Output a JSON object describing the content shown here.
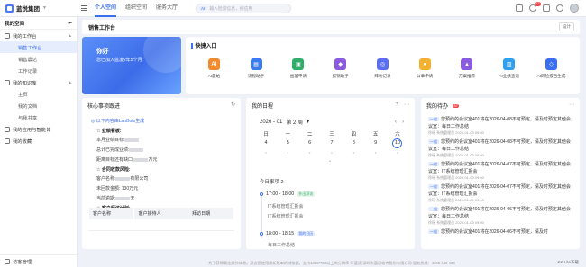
{
  "header": {
    "brand": "蓝悦集团",
    "tabs": [
      "个人空间",
      "组织空间",
      "服务大厅"
    ],
    "active_tab": 0,
    "search": {
      "tag": "AI",
      "placeholder": "输入检索信息，搜应用"
    },
    "notification_count": "27"
  },
  "sidebar": {
    "title": "我的空间",
    "groups": [
      {
        "label": "我的工作台",
        "items": [
          "销售工作台",
          "销售晨达",
          "工作记录"
        ]
      },
      {
        "label": "我的知识库",
        "items": [
          "主页",
          "我的文档",
          "与我共享"
        ]
      },
      {
        "label": "我的应用与智能体",
        "items": []
      },
      {
        "label": "我的收藏",
        "items": []
      }
    ],
    "footer": "访客管理"
  },
  "page": {
    "title": "销售工作台",
    "settings_label": "设计"
  },
  "welcome": {
    "greeting": "你好",
    "subtitle": "您已加入蓝凌2年5个月"
  },
  "quick_entry": {
    "title": "快捷入口",
    "items": [
      {
        "label": "AI晨始",
        "icon": "ai-icon",
        "glyph": "AI",
        "color": "#f28b2f"
      },
      {
        "label": "流程助手",
        "icon": "workflow-icon",
        "glyph": "▤",
        "color": "#3a7bf0"
      },
      {
        "label": "出差申请",
        "icon": "briefcase-icon",
        "glyph": "▣",
        "color": "#2fae6a"
      },
      {
        "label": "报销助手",
        "icon": "wallet-icon",
        "glyph": "◆",
        "color": "#8a5ae0"
      },
      {
        "label": "拜访记录",
        "icon": "team-icon",
        "glyph": "◎",
        "color": "#5a6ef0"
      },
      {
        "label": "公章申请",
        "icon": "stamp-icon",
        "glyph": "●",
        "color": "#f2b22f"
      },
      {
        "label": "方案推荐",
        "icon": "graduation-icon",
        "glyph": "▲",
        "color": "#8a5ae0"
      },
      {
        "label": "AI业绩查询",
        "icon": "chart-icon",
        "glyph": "▥",
        "color": "#2f9ff0"
      },
      {
        "label": "AI风险报告生成",
        "icon": "report-icon",
        "glyph": "◇",
        "color": "#3a6ff0"
      }
    ]
  },
  "core": {
    "title": "核心事项跟进",
    "link": "以下内容由LanBots生成",
    "sections": [
      {
        "heading": "业绩看板:",
        "rows": [
          "本月业绩目标:",
          "总计已完成业绩:",
          "距离目标还有缺口:"
        ],
        "suffix": [
          "",
          "",
          "万元"
        ]
      },
      {
        "heading": "合同收款风险:",
        "rows": [
          "客户名称:",
          "未回款金额: 130万元",
          "当前逾期:"
        ],
        "suffix": [
          "有限公司",
          "",
          "天"
        ]
      },
      {
        "heading": "客户拜访计划:",
        "rows": [],
        "suffix": []
      }
    ],
    "table_headers": [
      "客户名称",
      "客户接待人",
      "拜访日期"
    ]
  },
  "schedule": {
    "title": "我的日程",
    "month": "2026 - 01",
    "week": "第 2 周",
    "weekdays": [
      "日",
      "一",
      "二",
      "三",
      "四",
      "五",
      "六"
    ],
    "days": [
      "4",
      "5",
      "6",
      "7",
      "8",
      "9",
      "10"
    ],
    "today_index": 6,
    "count_label": "今日事项",
    "count": "2",
    "events": [
      {
        "time": "17:00 - 18:00",
        "tag": "外出拜访",
        "tag_style": "green",
        "lines": [
          "IT系统管理汇报会",
          "IT系统管理汇报会"
        ]
      },
      {
        "time": "18:00 - 18:15",
        "tag": "我的日历",
        "tag_style": "blue",
        "lines": [
          "每日工作总结"
        ]
      }
    ]
  },
  "todo": {
    "title": "我的待办",
    "badge": "87",
    "items": [
      {
        "tag": "一般",
        "text": "您预约的会议室401将在2026-04-08不可预定，请及时预定其他会议室：每日工作总结",
        "meta": "徐瑶    系统管理员    2026-01-09 09:00"
      },
      {
        "tag": "一般",
        "text": "您预约的会议室401将在2026-04-08不可预定，请及时预定其他会议室：每日工作总结",
        "meta": "徐瑶    系统管理员    2026-01-09 09:00"
      },
      {
        "tag": "一般",
        "text": "您预约的会议室401将在2026-04-07不可预定，请及时预定其他会议室：IT系统管理汇报会",
        "meta": "徐瑶    系统管理员    2026-01-09 09:00"
      },
      {
        "tag": "一般",
        "text": "您预约的会议室401将在2026-04-07不可预定，请及时预定其他会议室：IT系统管理汇报会",
        "meta": "徐瑶    系统管理员    2026-01-09 09:00"
      },
      {
        "tag": "一般",
        "text": "您预约的会议室401将在2026-04-06不可预定，请及时预定其他会议室：每日工作总结",
        "meta": "徐瑶    系统管理员    2026-01-09 09:00"
      },
      {
        "tag": "一般",
        "text": "您预约的会议室401将在2026-04-06不可预定，请及时",
        "meta": ""
      }
    ]
  },
  "footer": {
    "text": "为了获得最佳操作体验，建议您使用最新版本的浏览器，支持1366*768以上的分辨率     © 蓝凌 深圳市蓝凌软件股份有限公司 服务热线：4006-189-100",
    "right": "KK Lite下载"
  }
}
